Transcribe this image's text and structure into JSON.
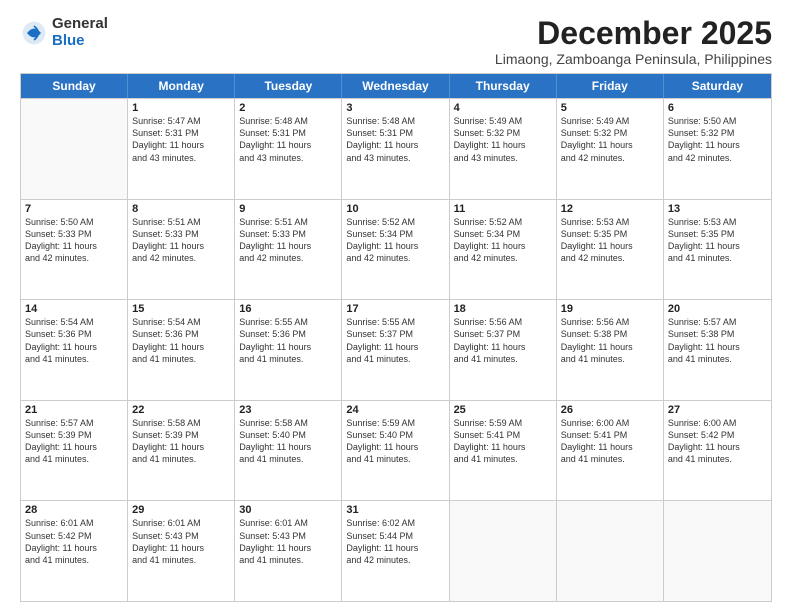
{
  "logo": {
    "general": "General",
    "blue": "Blue"
  },
  "title": "December 2025",
  "location": "Limaong, Zamboanga Peninsula, Philippines",
  "days_of_week": [
    "Sunday",
    "Monday",
    "Tuesday",
    "Wednesday",
    "Thursday",
    "Friday",
    "Saturday"
  ],
  "weeks": [
    [
      {
        "day": "",
        "lines": []
      },
      {
        "day": "1",
        "lines": [
          "Sunrise: 5:47 AM",
          "Sunset: 5:31 PM",
          "Daylight: 11 hours",
          "and 43 minutes."
        ]
      },
      {
        "day": "2",
        "lines": [
          "Sunrise: 5:48 AM",
          "Sunset: 5:31 PM",
          "Daylight: 11 hours",
          "and 43 minutes."
        ]
      },
      {
        "day": "3",
        "lines": [
          "Sunrise: 5:48 AM",
          "Sunset: 5:31 PM",
          "Daylight: 11 hours",
          "and 43 minutes."
        ]
      },
      {
        "day": "4",
        "lines": [
          "Sunrise: 5:49 AM",
          "Sunset: 5:32 PM",
          "Daylight: 11 hours",
          "and 43 minutes."
        ]
      },
      {
        "day": "5",
        "lines": [
          "Sunrise: 5:49 AM",
          "Sunset: 5:32 PM",
          "Daylight: 11 hours",
          "and 42 minutes."
        ]
      },
      {
        "day": "6",
        "lines": [
          "Sunrise: 5:50 AM",
          "Sunset: 5:32 PM",
          "Daylight: 11 hours",
          "and 42 minutes."
        ]
      }
    ],
    [
      {
        "day": "7",
        "lines": [
          "Sunrise: 5:50 AM",
          "Sunset: 5:33 PM",
          "Daylight: 11 hours",
          "and 42 minutes."
        ]
      },
      {
        "day": "8",
        "lines": [
          "Sunrise: 5:51 AM",
          "Sunset: 5:33 PM",
          "Daylight: 11 hours",
          "and 42 minutes."
        ]
      },
      {
        "day": "9",
        "lines": [
          "Sunrise: 5:51 AM",
          "Sunset: 5:33 PM",
          "Daylight: 11 hours",
          "and 42 minutes."
        ]
      },
      {
        "day": "10",
        "lines": [
          "Sunrise: 5:52 AM",
          "Sunset: 5:34 PM",
          "Daylight: 11 hours",
          "and 42 minutes."
        ]
      },
      {
        "day": "11",
        "lines": [
          "Sunrise: 5:52 AM",
          "Sunset: 5:34 PM",
          "Daylight: 11 hours",
          "and 42 minutes."
        ]
      },
      {
        "day": "12",
        "lines": [
          "Sunrise: 5:53 AM",
          "Sunset: 5:35 PM",
          "Daylight: 11 hours",
          "and 42 minutes."
        ]
      },
      {
        "day": "13",
        "lines": [
          "Sunrise: 5:53 AM",
          "Sunset: 5:35 PM",
          "Daylight: 11 hours",
          "and 41 minutes."
        ]
      }
    ],
    [
      {
        "day": "14",
        "lines": [
          "Sunrise: 5:54 AM",
          "Sunset: 5:36 PM",
          "Daylight: 11 hours",
          "and 41 minutes."
        ]
      },
      {
        "day": "15",
        "lines": [
          "Sunrise: 5:54 AM",
          "Sunset: 5:36 PM",
          "Daylight: 11 hours",
          "and 41 minutes."
        ]
      },
      {
        "day": "16",
        "lines": [
          "Sunrise: 5:55 AM",
          "Sunset: 5:36 PM",
          "Daylight: 11 hours",
          "and 41 minutes."
        ]
      },
      {
        "day": "17",
        "lines": [
          "Sunrise: 5:55 AM",
          "Sunset: 5:37 PM",
          "Daylight: 11 hours",
          "and 41 minutes."
        ]
      },
      {
        "day": "18",
        "lines": [
          "Sunrise: 5:56 AM",
          "Sunset: 5:37 PM",
          "Daylight: 11 hours",
          "and 41 minutes."
        ]
      },
      {
        "day": "19",
        "lines": [
          "Sunrise: 5:56 AM",
          "Sunset: 5:38 PM",
          "Daylight: 11 hours",
          "and 41 minutes."
        ]
      },
      {
        "day": "20",
        "lines": [
          "Sunrise: 5:57 AM",
          "Sunset: 5:38 PM",
          "Daylight: 11 hours",
          "and 41 minutes."
        ]
      }
    ],
    [
      {
        "day": "21",
        "lines": [
          "Sunrise: 5:57 AM",
          "Sunset: 5:39 PM",
          "Daylight: 11 hours",
          "and 41 minutes."
        ]
      },
      {
        "day": "22",
        "lines": [
          "Sunrise: 5:58 AM",
          "Sunset: 5:39 PM",
          "Daylight: 11 hours",
          "and 41 minutes."
        ]
      },
      {
        "day": "23",
        "lines": [
          "Sunrise: 5:58 AM",
          "Sunset: 5:40 PM",
          "Daylight: 11 hours",
          "and 41 minutes."
        ]
      },
      {
        "day": "24",
        "lines": [
          "Sunrise: 5:59 AM",
          "Sunset: 5:40 PM",
          "Daylight: 11 hours",
          "and 41 minutes."
        ]
      },
      {
        "day": "25",
        "lines": [
          "Sunrise: 5:59 AM",
          "Sunset: 5:41 PM",
          "Daylight: 11 hours",
          "and 41 minutes."
        ]
      },
      {
        "day": "26",
        "lines": [
          "Sunrise: 6:00 AM",
          "Sunset: 5:41 PM",
          "Daylight: 11 hours",
          "and 41 minutes."
        ]
      },
      {
        "day": "27",
        "lines": [
          "Sunrise: 6:00 AM",
          "Sunset: 5:42 PM",
          "Daylight: 11 hours",
          "and 41 minutes."
        ]
      }
    ],
    [
      {
        "day": "28",
        "lines": [
          "Sunrise: 6:01 AM",
          "Sunset: 5:42 PM",
          "Daylight: 11 hours",
          "and 41 minutes."
        ]
      },
      {
        "day": "29",
        "lines": [
          "Sunrise: 6:01 AM",
          "Sunset: 5:43 PM",
          "Daylight: 11 hours",
          "and 41 minutes."
        ]
      },
      {
        "day": "30",
        "lines": [
          "Sunrise: 6:01 AM",
          "Sunset: 5:43 PM",
          "Daylight: 11 hours",
          "and 41 minutes."
        ]
      },
      {
        "day": "31",
        "lines": [
          "Sunrise: 6:02 AM",
          "Sunset: 5:44 PM",
          "Daylight: 11 hours",
          "and 42 minutes."
        ]
      },
      {
        "day": "",
        "lines": []
      },
      {
        "day": "",
        "lines": []
      },
      {
        "day": "",
        "lines": []
      }
    ]
  ]
}
